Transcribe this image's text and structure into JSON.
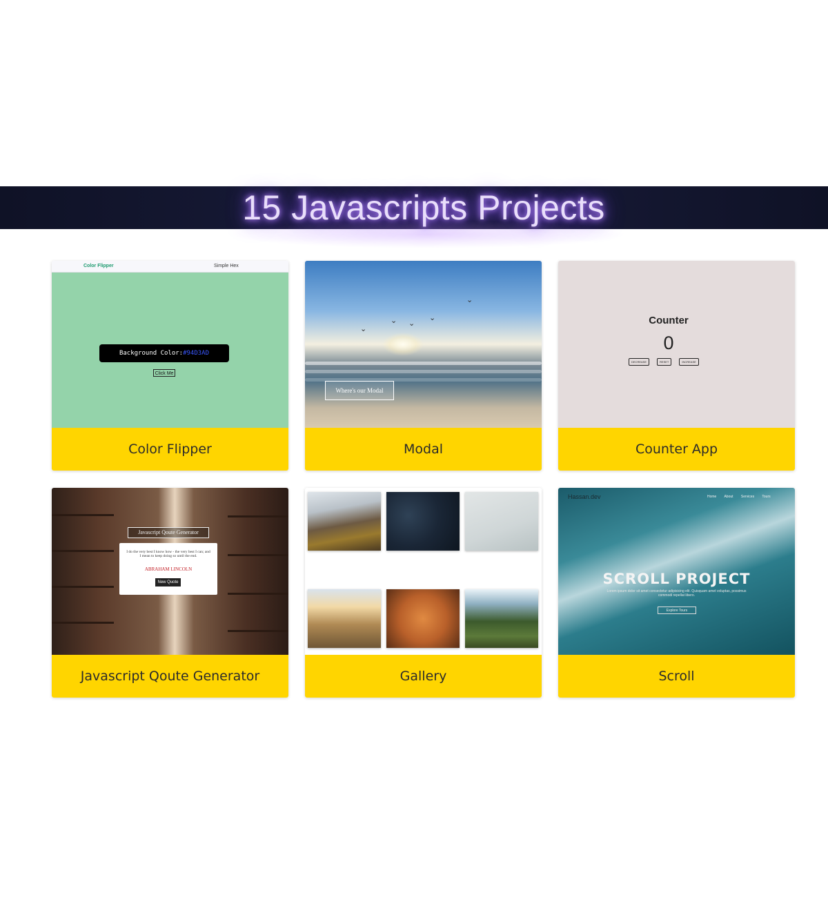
{
  "header": {
    "title": "15 Javascripts Projects"
  },
  "projects": [
    {
      "label": "Color Flipper",
      "preview": {
        "brand": "Color Flipper",
        "nav_links": "Simple   Hex",
        "bg_color_label": "Background Color: ",
        "bg_color_value": "#94D3AD",
        "button": "Click Me"
      }
    },
    {
      "label": "Modal",
      "preview": {
        "button": "Where's our Modal"
      }
    },
    {
      "label": "Counter App",
      "preview": {
        "title": "Counter",
        "value": "0",
        "buttons": [
          "DECREASE",
          "RESET",
          "INCREASE"
        ]
      }
    },
    {
      "label": "Javascript Qoute Generator",
      "preview": {
        "heading": "Javascript Qoute Generator",
        "quote": "I do the very best I know how - the very best I can; and I mean to keep doing so until the end.",
        "author": "ABRAHAM LINCOLN",
        "button": "New Quote"
      }
    },
    {
      "label": "Gallery",
      "preview": {}
    },
    {
      "label": "Scroll",
      "preview": {
        "brand": "Hassan.dev",
        "nav_links": "Home About Services Tours",
        "title": "SCROLL PROJECT",
        "text": "Lorem ipsum dolor sit amet consectetur adipisicing elit. Quisquam amet voluptas, possimus commodi repellat libero.",
        "button": "Explore Tours"
      }
    }
  ],
  "colors": {
    "label_bg": "#ffd500",
    "banner_bg": "#141730",
    "title_glow": "#b889ff",
    "color_flipper_bg": "#94d3aa"
  }
}
